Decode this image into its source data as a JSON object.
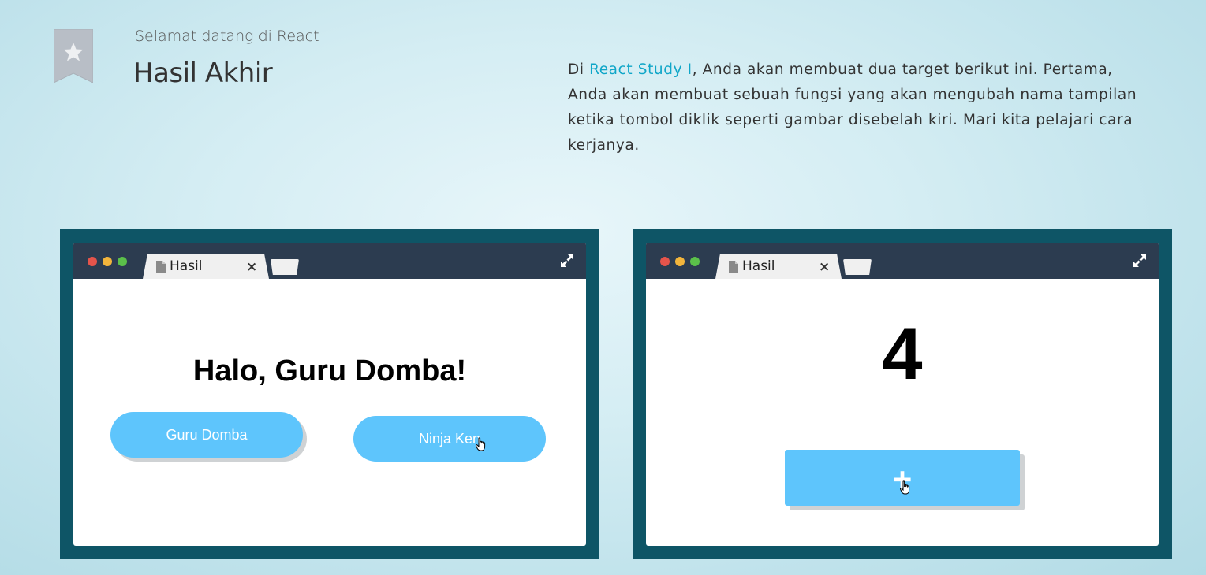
{
  "header": {
    "subtitle": "Selamat datang di React",
    "title": "Hasil Akhir",
    "intro_prefix": "Di ",
    "intro_link": "React Study I",
    "intro_rest": ", Anda akan membuat dua target berikut ini. Pertama, Anda akan membuat sebuah fungsi yang akan mengubah nama tampilan ketika tombol diklik seperti gambar disebelah kiri. Mari kita pelajari cara kerjanya."
  },
  "left_window": {
    "tab_label": "Hasil",
    "tab_close": "×",
    "greeting": "Halo, Guru Domba!",
    "button_one": "Guru Domba",
    "button_two": "Ninja Ken"
  },
  "right_window": {
    "tab_label": "Hasil",
    "tab_close": "×",
    "counter": "4",
    "plus_button": "+"
  },
  "colors": {
    "accent_link": "#0fa6c8",
    "button_blue": "#5ec5fc",
    "frame": "#0e5566",
    "titlebar": "#2c3c50"
  },
  "icons": [
    "bookmark-star-icon",
    "document-icon",
    "close-icon",
    "expand-icon",
    "hand-cursor-icon"
  ]
}
